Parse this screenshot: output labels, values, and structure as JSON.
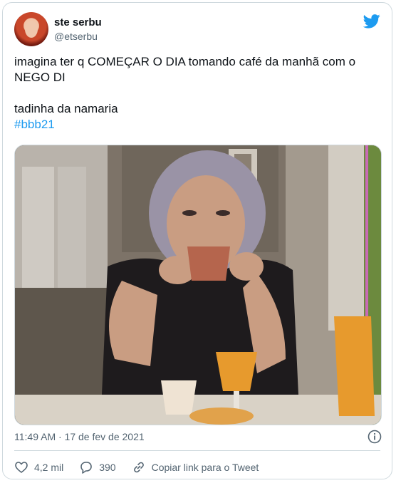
{
  "author": {
    "name": "ste serbu",
    "handle": "@etserbu",
    "avatar_icon": "profile-photo"
  },
  "tweet": {
    "line1": "imagina ter q COMEÇAR O DIA tomando café da manhã com o NEGO DI",
    "line2": "tadinha da namaria",
    "hashtag": "#bbb21",
    "timestamp": "11:49 AM · 17 de fev de 2021"
  },
  "actions": {
    "likes": "4,2 mil",
    "replies": "390",
    "copy_link": "Copiar link para o Tweet"
  },
  "icons": {
    "brand": "twitter-bird-icon",
    "info": "info-icon",
    "like": "heart-icon",
    "reply": "speech-bubble-icon",
    "link": "link-icon"
  },
  "colors": {
    "brand_blue": "#1d9bf0",
    "text": "#0f1419",
    "muted": "#536471",
    "border": "#cfd9de"
  }
}
